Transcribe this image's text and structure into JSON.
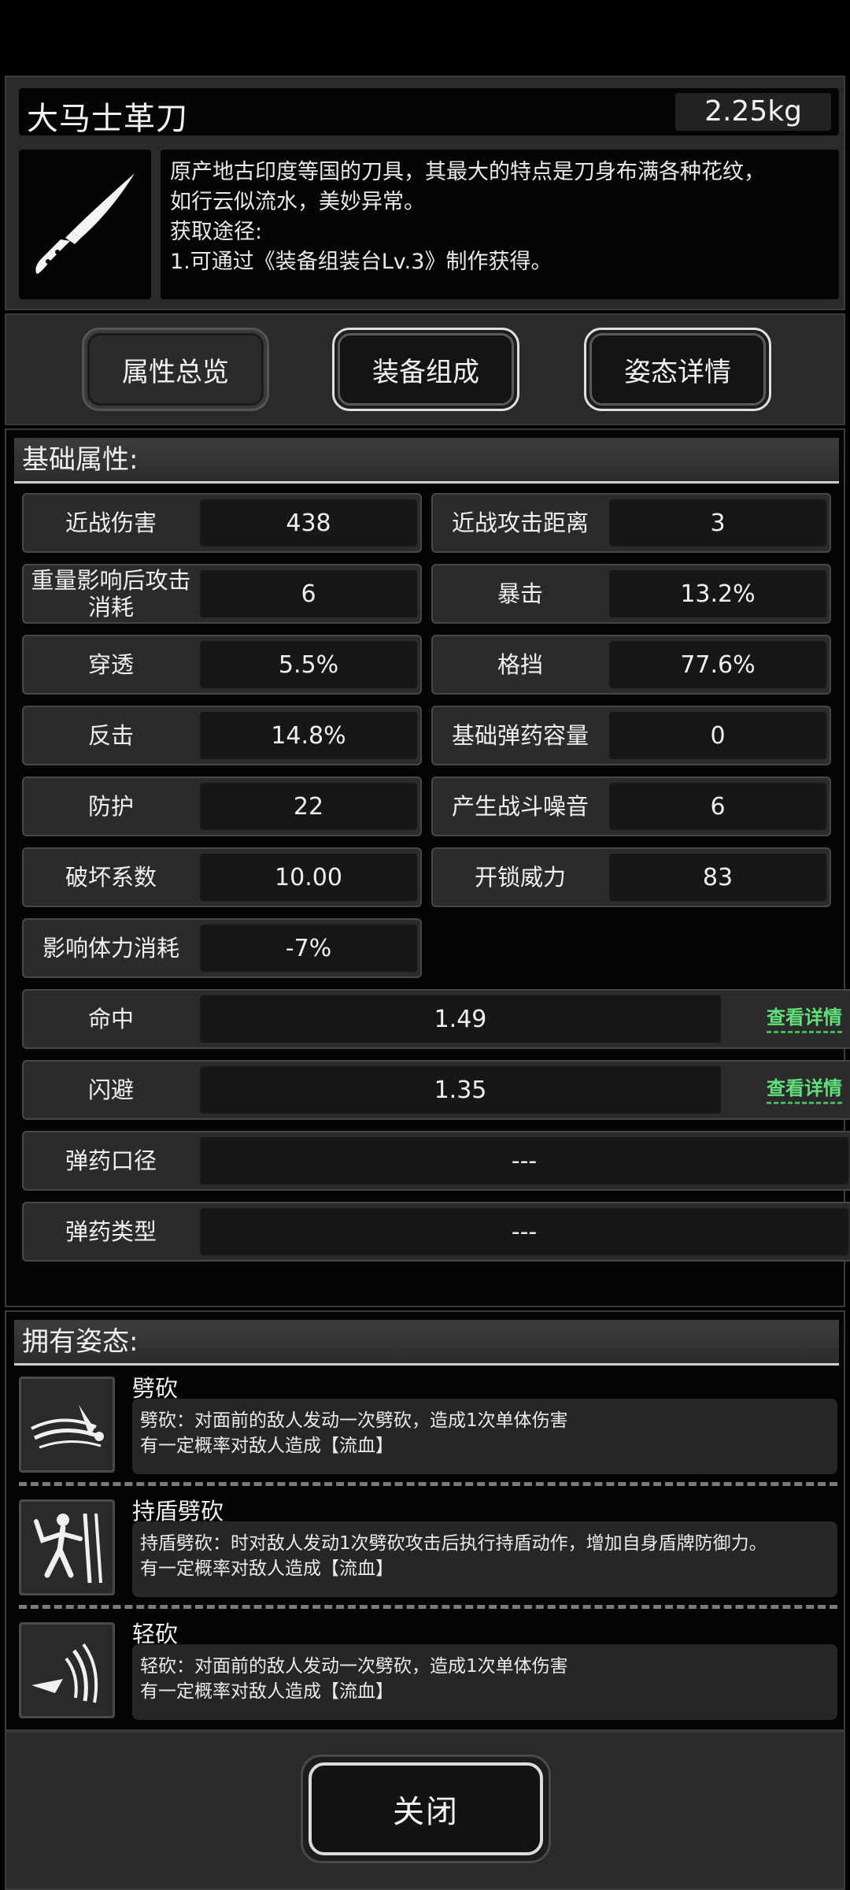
{
  "item": {
    "name": "大马士革刀",
    "weight": "2.25kg",
    "icon": "knife-icon",
    "description_lines": [
      "原产地古印度等国的刀具，其最大的特点是刀身布满各种花纹，",
      "如行云似流水，美妙异常。",
      "获取途径:",
      "1.可通过《装备组装台Lv.3》制作获得。"
    ]
  },
  "tabs": [
    {
      "label": "属性总览",
      "active": true
    },
    {
      "label": "装备组成",
      "active": false
    },
    {
      "label": "姿态详情",
      "active": false
    }
  ],
  "attributes": {
    "header": "基础属性:",
    "pairs": [
      {
        "label": "近战伤害",
        "value": "438"
      },
      {
        "label": "近战攻击距离",
        "value": "3"
      },
      {
        "label": "重量影响后攻击消耗",
        "value": "6"
      },
      {
        "label": "暴击",
        "value": "13.2%"
      },
      {
        "label": "穿透",
        "value": "5.5%"
      },
      {
        "label": "格挡",
        "value": "77.6%"
      },
      {
        "label": "反击",
        "value": "14.8%"
      },
      {
        "label": "基础弹药容量",
        "value": "0"
      },
      {
        "label": "防护",
        "value": "22"
      },
      {
        "label": "产生战斗噪音",
        "value": "6"
      },
      {
        "label": "破坏系数",
        "value": "10.00"
      },
      {
        "label": "开锁威力",
        "value": "83"
      },
      {
        "label": "影响体力消耗",
        "value": "-7%"
      }
    ],
    "full": [
      {
        "label": "命中",
        "value": "1.49",
        "link": "查看详情"
      },
      {
        "label": "闪避",
        "value": "1.35",
        "link": "查看详情"
      },
      {
        "label": "弹药口径",
        "value": "---"
      },
      {
        "label": "弹药类型",
        "value": "---"
      }
    ]
  },
  "stances": {
    "header": "拥有姿态:",
    "items": [
      {
        "name": "劈砍",
        "icon": "slash-icon",
        "desc1": "劈砍：对面前的敌人发动一次劈砍，造成1次单体伤害",
        "desc2": "有一定概率对敌人造成【流血】"
      },
      {
        "name": "持盾劈砍",
        "icon": "shield-stance-icon",
        "desc1": "持盾劈砍：时对敌人发动1次劈砍攻击后执行持盾动作，增加自身盾牌防御力。",
        "desc2": "有一定概率对敌人造成【流血】"
      },
      {
        "name": "轻砍",
        "icon": "light-slash-icon",
        "desc1": "轻砍：对面前的敌人发动一次劈砍，造成1次单体伤害",
        "desc2": "有一定概率对敌人造成【流血】"
      }
    ]
  },
  "close_label": "关闭"
}
